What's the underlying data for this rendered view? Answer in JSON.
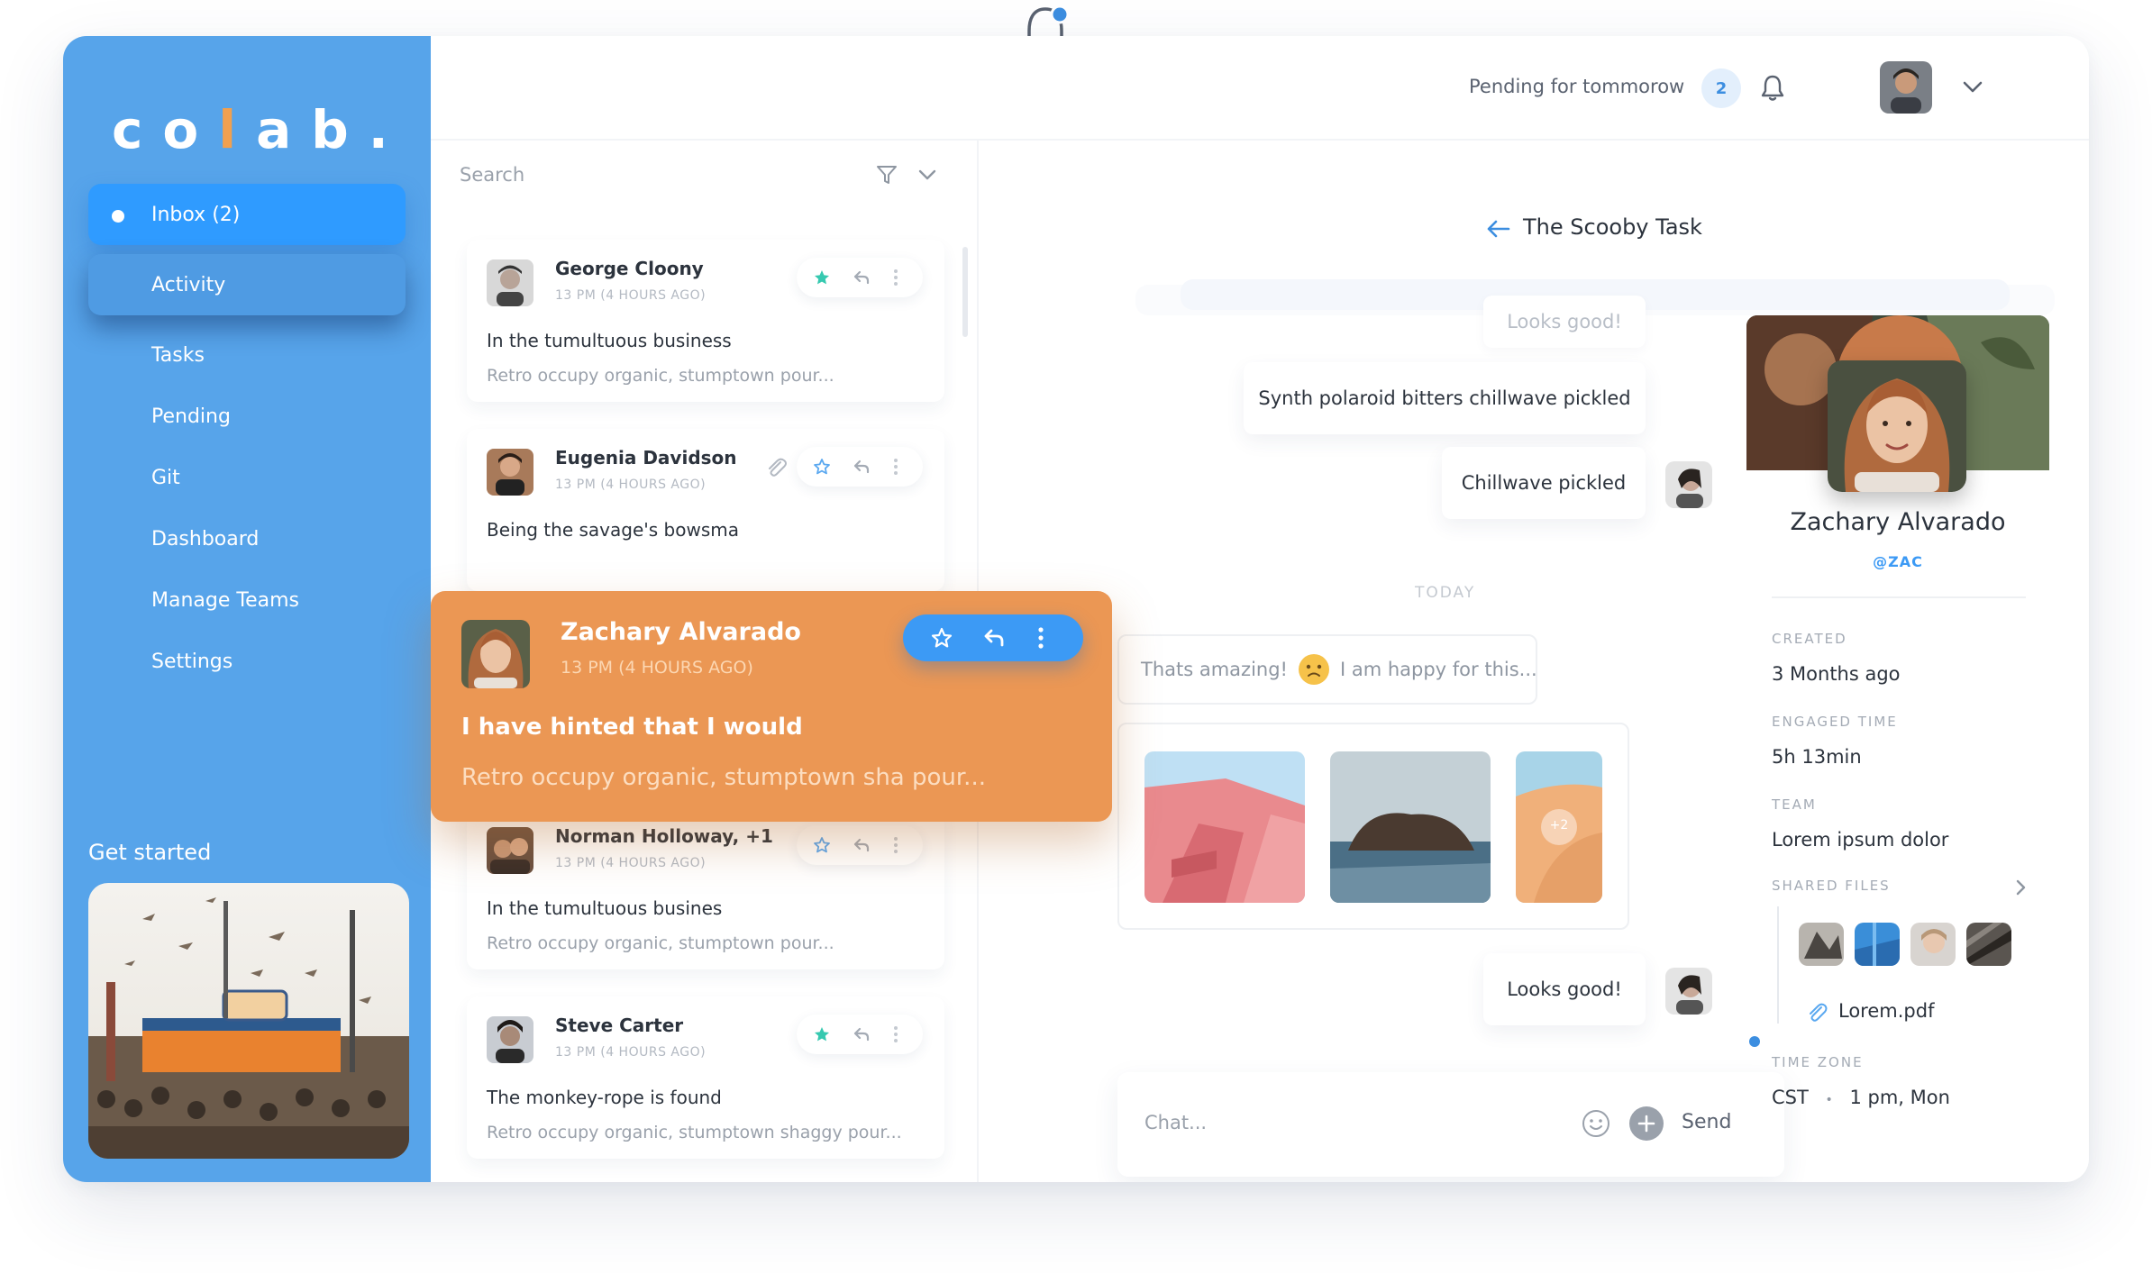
{
  "app": {
    "logo_text": "co",
    "logo_l": "l",
    "logo_end": "ab.",
    "brand_color": "#57A4EA",
    "accent_color": "#EB9754"
  },
  "header": {
    "pending_text": "Pending for tommorow",
    "pending_count": "2"
  },
  "sidebar": {
    "items": [
      {
        "label": "Inbox (2)"
      },
      {
        "label": "Activity"
      },
      {
        "label": "Tasks"
      },
      {
        "label": "Pending"
      },
      {
        "label": "Git"
      },
      {
        "label": "Dashboard"
      },
      {
        "label": "Manage Teams"
      },
      {
        "label": "Settings"
      }
    ],
    "get_started": "Get started"
  },
  "list": {
    "search_placeholder": "Search",
    "messages": [
      {
        "name": "George Cloony",
        "time": "13 PM (4 HOURS AGO)",
        "subject": "In the tumultuous business",
        "preview": "Retro occupy organic, stumptown pour..."
      },
      {
        "name": "Eugenia Davidson",
        "time": "13 PM (4 HOURS AGO)",
        "subject": "Being the savage's bowsma",
        "preview": ""
      },
      {
        "name": "Norman Holloway, +1",
        "time": "13 PM (4 HOURS AGO)",
        "subject": "In the tumultuous busines",
        "preview": "Retro occupy organic, stumptown pour..."
      },
      {
        "name": "Steve Carter",
        "time": "13 PM (4 HOURS AGO)",
        "subject": "The monkey-rope is found",
        "preview": "Retro occupy organic, stumptown shaggy pour..."
      }
    ],
    "highlighted": {
      "name": "Zachary Alvarado",
      "time": "13 PM (4 HOURS AGO)",
      "subject": "I have hinted that I would",
      "preview": "Retro occupy organic, stumptown sha pour..."
    }
  },
  "chat": {
    "title": "The Scooby Task",
    "messages": [
      {
        "text": "Looks good!"
      },
      {
        "text": "Synth polaroid bitters chillwave pickled"
      },
      {
        "text": "Chillwave pickled"
      }
    ],
    "day_separator": "TODAY",
    "incoming_1": "Thats amazing!",
    "incoming_2": "I am happy for this...",
    "gallery_more": "+2",
    "last_message": "Looks good!",
    "input_placeholder": "Chat...",
    "send_label": "Send"
  },
  "profile": {
    "name": "Zachary Alvarado",
    "handle": "@ZAC",
    "created_label": "CREATED",
    "created_value": "3 Months ago",
    "engaged_label": "ENGAGED TIME",
    "engaged_value": "5h 13min",
    "team_label": "TEAM",
    "team_value": "Lorem ipsum dolor",
    "files_label": "SHARED FILES",
    "file_name": "Lorem.pdf",
    "tz_label": "TIME ZONE",
    "tz_value": "CST",
    "tz_sep": "•",
    "tz_time": "1 pm, Mon"
  }
}
